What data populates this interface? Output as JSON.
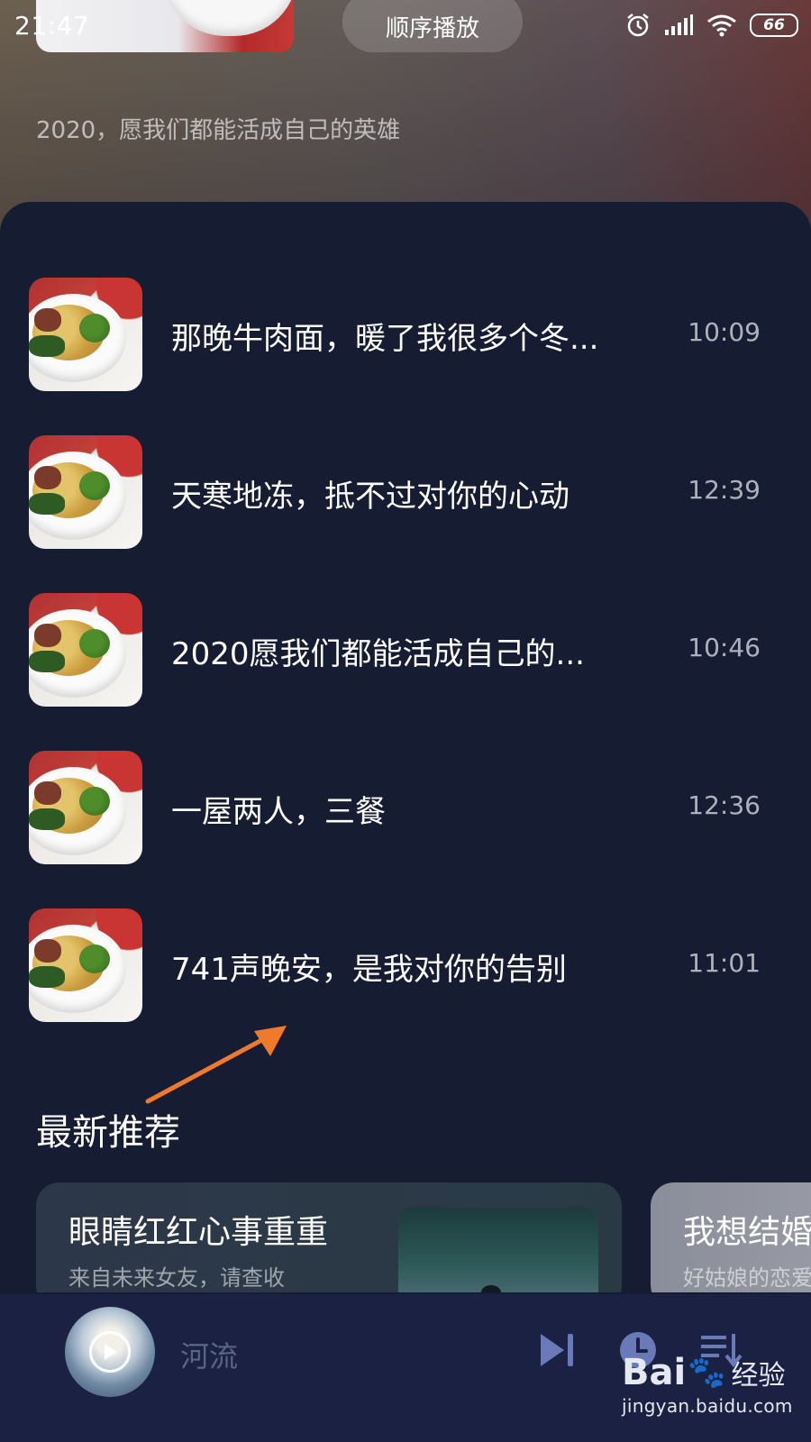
{
  "status_bar": {
    "time": "21:47",
    "battery": "66"
  },
  "header": {
    "play_mode": "顺序播放",
    "description": "2020，愿我们都能活成自己的英雄"
  },
  "episodes": [
    {
      "title": "那晚牛肉面，暖了我很多个冬...",
      "duration": "10:09"
    },
    {
      "title": "天寒地冻，抵不过对你的心动",
      "duration": "12:39"
    },
    {
      "title": "2020愿我们都能活成自己的...",
      "duration": "10:46"
    },
    {
      "title": "一屋两人，三餐",
      "duration": "12:36"
    },
    {
      "title": "741声晚安，是我对你的告别",
      "duration": "11:01"
    }
  ],
  "recommend": {
    "section_title": "最新推荐",
    "cards": [
      {
        "title": "眼睛红红心事重重",
        "subtitle": "来自未来女友，请查收"
      },
      {
        "title": "我想结婚",
        "subtitle": "好姑娘的恋爱"
      }
    ]
  },
  "player": {
    "title": "河流"
  },
  "watermark": {
    "logo_left": "Bai",
    "logo_right": "经验",
    "url": "jingyan.baidu.com"
  },
  "colors": {
    "panel_bg": "#161d33",
    "player_bg": "#1a2142",
    "accent_icons": "#6a7ab8",
    "arrow": "#f07a2a"
  }
}
